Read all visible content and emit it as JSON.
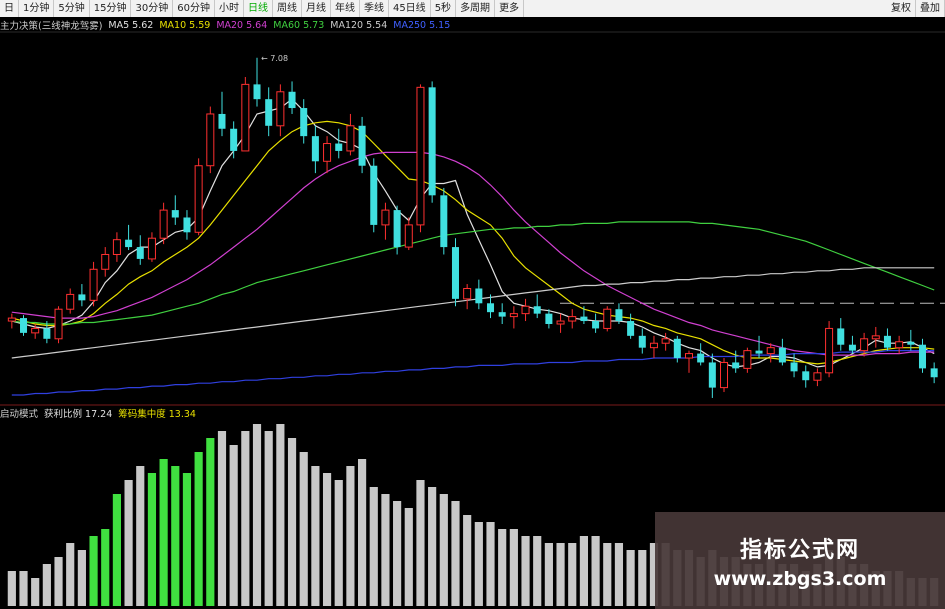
{
  "toolbar": {
    "items": [
      "日",
      "1分钟",
      "5分钟",
      "15分钟",
      "30分钟",
      "60分钟",
      "小时",
      "日线",
      "周线",
      "月线",
      "年线",
      "季线",
      "45日线",
      "5秒",
      "多周期",
      "更多"
    ],
    "active_index": 7,
    "right": [
      "复权",
      "叠加"
    ]
  },
  "indicator_bar": {
    "title": "主力决策(三线神龙驾雾)",
    "ma": [
      {
        "label": "MA5",
        "value": "5.62",
        "color": "#e0e0e0"
      },
      {
        "label": "MA10",
        "value": "5.59",
        "color": "#e8e000"
      },
      {
        "label": "MA20",
        "value": "5.64",
        "color": "#d040d0"
      },
      {
        "label": "MA60",
        "value": "5.73",
        "color": "#40d040"
      },
      {
        "label": "MA120",
        "value": "5.54",
        "color": "#cccccc"
      },
      {
        "label": "MA250",
        "value": "5.15",
        "color": "#4060ff"
      }
    ]
  },
  "volume_bar": {
    "title": "启动模式",
    "items": [
      {
        "label": "获利比例",
        "value": "17.24",
        "color": "#e0e0e0"
      },
      {
        "label": "筹码集中度",
        "value": "13.34",
        "color": "#e8e000"
      }
    ]
  },
  "annotations": {
    "peak_label": "7.08"
  },
  "watermark": {
    "title": "指标公式网",
    "url": "www.zbgs3.com"
  },
  "chart_data": {
    "type": "candlestick",
    "up_color": "#ff3030",
    "down_color": "#40e0e0",
    "price_range": [
      4.8,
      7.2
    ],
    "candles": [
      [
        5.3,
        5.35,
        5.25,
        5.32
      ],
      [
        5.32,
        5.34,
        5.2,
        5.22
      ],
      [
        5.22,
        5.28,
        5.18,
        5.25
      ],
      [
        5.25,
        5.3,
        5.15,
        5.18
      ],
      [
        5.18,
        5.4,
        5.15,
        5.38
      ],
      [
        5.38,
        5.52,
        5.35,
        5.48
      ],
      [
        5.48,
        5.55,
        5.4,
        5.44
      ],
      [
        5.44,
        5.7,
        5.4,
        5.65
      ],
      [
        5.65,
        5.8,
        5.6,
        5.75
      ],
      [
        5.75,
        5.9,
        5.7,
        5.85
      ],
      [
        5.85,
        5.95,
        5.78,
        5.8
      ],
      [
        5.8,
        5.88,
        5.68,
        5.72
      ],
      [
        5.72,
        5.9,
        5.7,
        5.86
      ],
      [
        5.86,
        6.1,
        5.82,
        6.05
      ],
      [
        6.05,
        6.15,
        5.95,
        6.0
      ],
      [
        6.0,
        6.05,
        5.85,
        5.9
      ],
      [
        5.9,
        6.4,
        5.88,
        6.35
      ],
      [
        6.35,
        6.75,
        6.3,
        6.7
      ],
      [
        6.7,
        6.85,
        6.55,
        6.6
      ],
      [
        6.6,
        6.65,
        6.4,
        6.45
      ],
      [
        6.45,
        6.95,
        6.45,
        6.9
      ],
      [
        6.9,
        7.08,
        6.75,
        6.8
      ],
      [
        6.8,
        6.88,
        6.55,
        6.62
      ],
      [
        6.62,
        6.9,
        6.55,
        6.85
      ],
      [
        6.85,
        6.92,
        6.7,
        6.74
      ],
      [
        6.74,
        6.8,
        6.5,
        6.55
      ],
      [
        6.55,
        6.62,
        6.3,
        6.38
      ],
      [
        6.38,
        6.55,
        6.3,
        6.5
      ],
      [
        6.5,
        6.6,
        6.4,
        6.45
      ],
      [
        6.45,
        6.7,
        6.42,
        6.62
      ],
      [
        6.62,
        6.68,
        6.3,
        6.35
      ],
      [
        6.35,
        6.4,
        5.9,
        5.95
      ],
      [
        5.95,
        6.1,
        5.85,
        6.05
      ],
      [
        6.05,
        6.08,
        5.75,
        5.8
      ],
      [
        5.8,
        6.0,
        5.78,
        5.95
      ],
      [
        5.95,
        6.9,
        5.9,
        6.88
      ],
      [
        6.88,
        6.92,
        6.1,
        6.15
      ],
      [
        6.15,
        6.2,
        5.75,
        5.8
      ],
      [
        5.8,
        5.86,
        5.4,
        5.45
      ],
      [
        5.45,
        5.55,
        5.38,
        5.52
      ],
      [
        5.52,
        5.58,
        5.38,
        5.42
      ],
      [
        5.42,
        5.48,
        5.32,
        5.36
      ],
      [
        5.36,
        5.42,
        5.28,
        5.33
      ],
      [
        5.33,
        5.4,
        5.25,
        5.35
      ],
      [
        5.35,
        5.45,
        5.3,
        5.4
      ],
      [
        5.4,
        5.48,
        5.32,
        5.35
      ],
      [
        5.35,
        5.38,
        5.25,
        5.28
      ],
      [
        5.28,
        5.35,
        5.22,
        5.3
      ],
      [
        5.3,
        5.38,
        5.25,
        5.33
      ],
      [
        5.33,
        5.4,
        5.28,
        5.3
      ],
      [
        5.3,
        5.35,
        5.22,
        5.25
      ],
      [
        5.25,
        5.4,
        5.23,
        5.38
      ],
      [
        5.38,
        5.42,
        5.28,
        5.3
      ],
      [
        5.3,
        5.35,
        5.18,
        5.2
      ],
      [
        5.2,
        5.25,
        5.08,
        5.12
      ],
      [
        5.12,
        5.2,
        5.05,
        5.15
      ],
      [
        5.15,
        5.22,
        5.1,
        5.18
      ],
      [
        5.18,
        5.2,
        5.02,
        5.05
      ],
      [
        5.05,
        5.1,
        4.95,
        5.08
      ],
      [
        5.08,
        5.15,
        5.0,
        5.02
      ],
      [
        5.02,
        5.08,
        4.78,
        4.85
      ],
      [
        4.85,
        5.05,
        4.82,
        5.02
      ],
      [
        5.02,
        5.1,
        4.95,
        4.98
      ],
      [
        4.98,
        5.12,
        4.95,
        5.1
      ],
      [
        5.1,
        5.2,
        5.05,
        5.08
      ],
      [
        5.08,
        5.15,
        5.02,
        5.12
      ],
      [
        5.12,
        5.18,
        5.0,
        5.02
      ],
      [
        5.02,
        5.08,
        4.92,
        4.96
      ],
      [
        4.96,
        5.0,
        4.85,
        4.9
      ],
      [
        4.9,
        4.98,
        4.86,
        4.95
      ],
      [
        4.95,
        5.3,
        4.92,
        5.25
      ],
      [
        5.25,
        5.32,
        5.1,
        5.14
      ],
      [
        5.14,
        5.2,
        5.08,
        5.1
      ],
      [
        5.1,
        5.22,
        5.06,
        5.18
      ],
      [
        5.18,
        5.26,
        5.12,
        5.2
      ],
      [
        5.2,
        5.25,
        5.1,
        5.12
      ],
      [
        5.12,
        5.2,
        5.08,
        5.16
      ],
      [
        5.16,
        5.24,
        5.1,
        5.14
      ],
      [
        5.14,
        5.18,
        4.95,
        4.98
      ],
      [
        4.98,
        5.02,
        4.88,
        4.92
      ]
    ],
    "ma_series": [
      {
        "name": "MA5",
        "color": "#e0e0e0",
        "values": [
          5.3,
          5.28,
          5.26,
          5.25,
          5.27,
          5.3,
          5.34,
          5.43,
          5.56,
          5.64,
          5.75,
          5.8,
          5.8,
          5.85,
          5.9,
          5.92,
          6.0,
          6.18,
          6.35,
          6.45,
          6.56,
          6.7,
          6.72,
          6.74,
          6.8,
          6.72,
          6.62,
          6.58,
          6.52,
          6.5,
          6.46,
          6.3,
          6.18,
          6.05,
          5.98,
          6.13,
          6.23,
          6.23,
          6.25,
          6.02,
          5.85,
          5.68,
          5.5,
          5.42,
          5.4,
          5.38,
          5.37,
          5.35,
          5.32,
          5.31,
          5.3,
          5.3,
          5.3,
          5.29,
          5.26,
          5.22,
          5.19,
          5.15,
          5.12,
          5.1,
          5.05,
          5.01,
          4.99,
          5.0,
          5.02,
          5.06,
          5.06,
          5.05,
          5.02,
          4.99,
          5.0,
          5.04,
          5.08,
          5.12,
          5.17,
          5.15,
          5.15,
          5.16,
          5.12,
          5.08
        ]
      },
      {
        "name": "MA10",
        "color": "#e8e000",
        "values": [
          5.32,
          5.3,
          5.28,
          5.27,
          5.27,
          5.28,
          5.3,
          5.35,
          5.42,
          5.48,
          5.55,
          5.6,
          5.64,
          5.7,
          5.75,
          5.8,
          5.86,
          5.95,
          6.05,
          6.15,
          6.25,
          6.35,
          6.45,
          6.52,
          6.58,
          6.62,
          6.64,
          6.65,
          6.64,
          6.62,
          6.58,
          6.5,
          6.42,
          6.34,
          6.26,
          6.25,
          6.22,
          6.18,
          6.12,
          6.05,
          6.0,
          5.95,
          5.86,
          5.74,
          5.66,
          5.6,
          5.54,
          5.48,
          5.42,
          5.38,
          5.36,
          5.34,
          5.33,
          5.32,
          5.3,
          5.27,
          5.25,
          5.22,
          5.2,
          5.18,
          5.14,
          5.1,
          5.07,
          5.05,
          5.05,
          5.05,
          5.04,
          5.03,
          5.02,
          5.01,
          5.02,
          5.04,
          5.06,
          5.08,
          5.1,
          5.11,
          5.12,
          5.12,
          5.12,
          5.11
        ]
      },
      {
        "name": "MA20",
        "color": "#d040d0",
        "values": [
          5.36,
          5.35,
          5.34,
          5.33,
          5.32,
          5.32,
          5.32,
          5.33,
          5.35,
          5.37,
          5.4,
          5.43,
          5.46,
          5.5,
          5.54,
          5.58,
          5.63,
          5.68,
          5.74,
          5.8,
          5.86,
          5.92,
          5.99,
          6.06,
          6.13,
          6.2,
          6.26,
          6.31,
          6.35,
          6.38,
          6.41,
          6.43,
          6.44,
          6.44,
          6.44,
          6.44,
          6.43,
          6.41,
          6.38,
          6.34,
          6.29,
          6.22,
          6.14,
          6.05,
          5.97,
          5.9,
          5.83,
          5.76,
          5.7,
          5.64,
          5.59,
          5.54,
          5.5,
          5.46,
          5.42,
          5.38,
          5.35,
          5.32,
          5.29,
          5.27,
          5.24,
          5.22,
          5.2,
          5.18,
          5.16,
          5.14,
          5.12,
          5.1,
          5.09,
          5.08,
          5.07,
          5.07,
          5.07,
          5.07,
          5.08,
          5.08,
          5.08,
          5.09,
          5.09,
          5.09
        ]
      },
      {
        "name": "MA60",
        "color": "#40d040",
        "values": [
          5.3,
          5.29,
          5.29,
          5.28,
          5.28,
          5.28,
          5.29,
          5.29,
          5.3,
          5.31,
          5.32,
          5.33,
          5.34,
          5.36,
          5.38,
          5.4,
          5.42,
          5.45,
          5.48,
          5.5,
          5.53,
          5.56,
          5.58,
          5.6,
          5.62,
          5.64,
          5.66,
          5.68,
          5.7,
          5.72,
          5.74,
          5.76,
          5.78,
          5.8,
          5.82,
          5.84,
          5.86,
          5.88,
          5.89,
          5.9,
          5.91,
          5.92,
          5.92,
          5.93,
          5.93,
          5.94,
          5.94,
          5.95,
          5.95,
          5.96,
          5.96,
          5.96,
          5.97,
          5.97,
          5.97,
          5.97,
          5.97,
          5.97,
          5.97,
          5.96,
          5.96,
          5.95,
          5.94,
          5.93,
          5.92,
          5.9,
          5.88,
          5.86,
          5.84,
          5.81,
          5.78,
          5.75,
          5.72,
          5.69,
          5.66,
          5.63,
          5.6,
          5.57,
          5.54,
          5.51
        ]
      },
      {
        "name": "MA120",
        "color": "#cccccc",
        "values": [
          5.05,
          5.06,
          5.07,
          5.08,
          5.09,
          5.1,
          5.11,
          5.12,
          5.13,
          5.14,
          5.15,
          5.16,
          5.17,
          5.18,
          5.19,
          5.2,
          5.21,
          5.22,
          5.23,
          5.24,
          5.25,
          5.26,
          5.27,
          5.28,
          5.29,
          5.3,
          5.31,
          5.32,
          5.33,
          5.34,
          5.35,
          5.36,
          5.37,
          5.38,
          5.39,
          5.4,
          5.41,
          5.42,
          5.43,
          5.44,
          5.45,
          5.46,
          5.47,
          5.48,
          5.49,
          5.5,
          5.51,
          5.52,
          5.53,
          5.54,
          5.54,
          5.55,
          5.55,
          5.56,
          5.56,
          5.57,
          5.57,
          5.58,
          5.58,
          5.59,
          5.59,
          5.6,
          5.6,
          5.61,
          5.61,
          5.62,
          5.62,
          5.63,
          5.63,
          5.64,
          5.64,
          5.65,
          5.65,
          5.66,
          5.66,
          5.66,
          5.66,
          5.66,
          5.66,
          5.66
        ]
      },
      {
        "name": "MA250",
        "color": "#3040e0",
        "values": [
          4.8,
          4.8,
          4.81,
          4.81,
          4.82,
          4.82,
          4.83,
          4.83,
          4.84,
          4.84,
          4.85,
          4.85,
          4.86,
          4.86,
          4.87,
          4.87,
          4.88,
          4.88,
          4.89,
          4.89,
          4.9,
          4.9,
          4.91,
          4.91,
          4.92,
          4.92,
          4.93,
          4.93,
          4.94,
          4.94,
          4.95,
          4.95,
          4.96,
          4.96,
          4.97,
          4.97,
          4.98,
          4.98,
          4.99,
          4.99,
          5.0,
          5.0,
          5.0,
          5.01,
          5.01,
          5.01,
          5.02,
          5.02,
          5.02,
          5.03,
          5.03,
          5.03,
          5.04,
          5.04,
          5.04,
          5.05,
          5.05,
          5.05,
          5.05,
          5.06,
          5.06,
          5.06,
          5.06,
          5.07,
          5.07,
          5.07,
          5.07,
          5.08,
          5.08,
          5.08,
          5.08,
          5.09,
          5.09,
          5.09,
          5.09,
          5.1,
          5.1,
          5.1,
          5.1,
          5.1
        ]
      }
    ],
    "volume": [
      5,
      5,
      4,
      6,
      7,
      9,
      8,
      10,
      11,
      16,
      18,
      20,
      19,
      21,
      20,
      19,
      22,
      24,
      25,
      23,
      25,
      26,
      25,
      26,
      24,
      22,
      20,
      19,
      18,
      20,
      21,
      17,
      16,
      15,
      14,
      18,
      17,
      16,
      15,
      13,
      12,
      12,
      11,
      11,
      10,
      10,
      9,
      9,
      9,
      10,
      10,
      9,
      9,
      8,
      8,
      9,
      9,
      8,
      8,
      7,
      8,
      7,
      7,
      6,
      6,
      7,
      6,
      6,
      5,
      6,
      8,
      7,
      6,
      6,
      5,
      5,
      5,
      4,
      4,
      4
    ],
    "volume_highlight_ranges": [
      [
        7,
        9
      ],
      [
        12,
        17
      ]
    ],
    "volume_colors": {
      "normal": "#c8c8c8",
      "highlight": "#40e040"
    }
  }
}
